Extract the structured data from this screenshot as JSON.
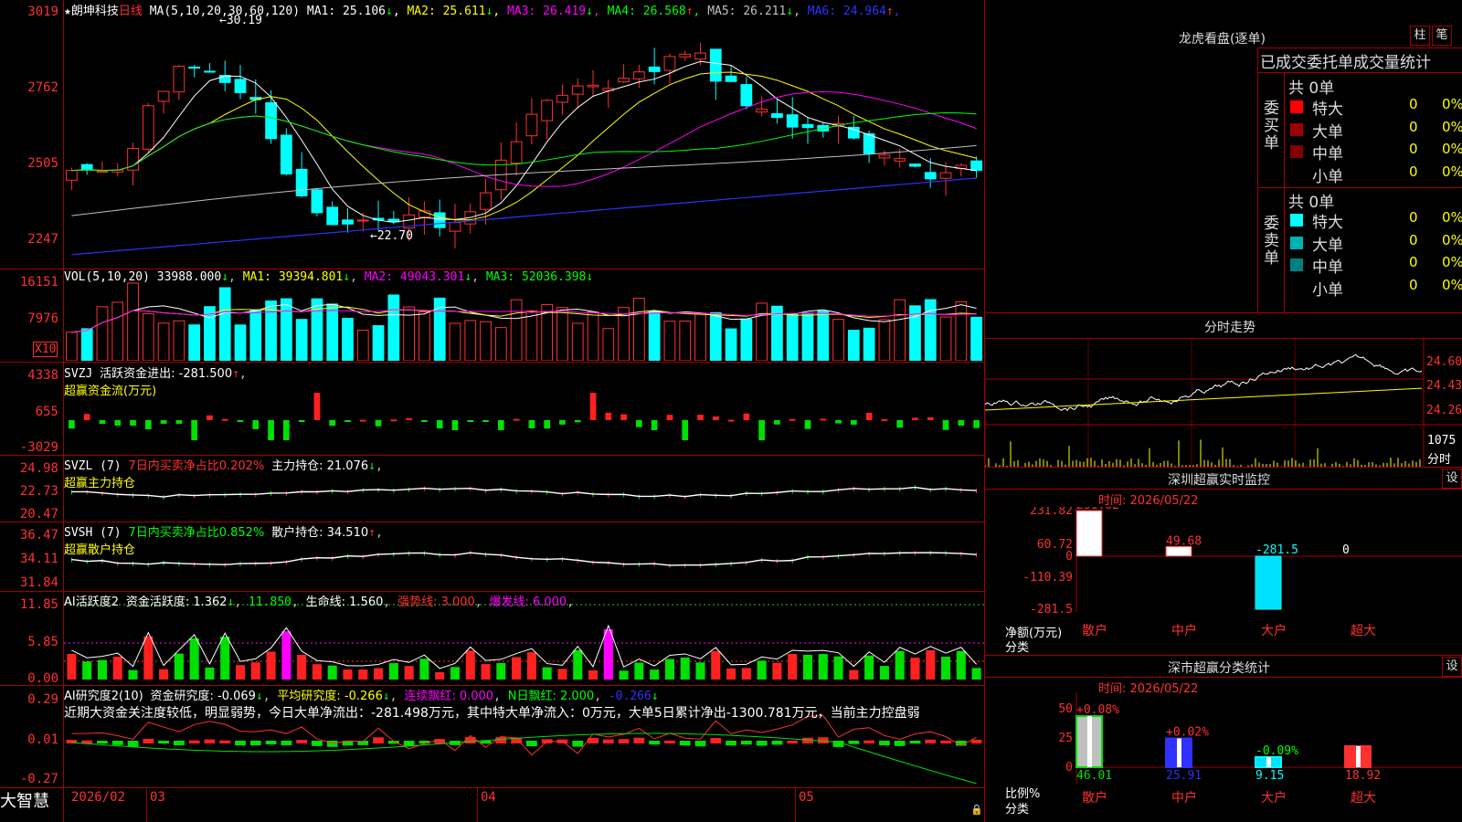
{
  "stock": {
    "name": "朗坤科技",
    "period": "日线"
  },
  "main": {
    "ma_label": "MA(5,10,20,30,60,120)",
    "ma": [
      {
        "label": "MA1:",
        "value": "25.106",
        "arrow": "↓",
        "color": "#ffffff"
      },
      {
        "label": "MA2:",
        "value": "25.611",
        "arrow": "↓",
        "color": "#ffff00"
      },
      {
        "label": "MA3:",
        "value": "26.419",
        "arrow": "↓",
        "color": "#ff00ff"
      },
      {
        "label": "MA4:",
        "value": "26.568",
        "arrow": "↑",
        "color": "#00ff00"
      },
      {
        "label": "MA5:",
        "value": "26.211",
        "arrow": "↓",
        "color": "#c0c0c0"
      },
      {
        "label": "MA6:",
        "value": "24.964",
        "arrow": "↑",
        "color": "#3030ff"
      }
    ],
    "yticks": [
      "3019",
      "2762",
      "2505",
      "2247"
    ],
    "high_label": "30.19",
    "low_label": "22.70"
  },
  "vol": {
    "label": "VOL(5,10,20)",
    "value": "33988.000",
    "ma1": "MA1: 39394.801",
    "ma2": "MA2: 49043.301",
    "ma3": "MA3: 52036.398",
    "yticks": [
      "16151",
      "7976"
    ],
    "unit": "X10"
  },
  "svzj": {
    "label": "SVZJ",
    "desc": "活跃资金进出: -281.500",
    "arrow": "↑",
    "sub": "超赢资金流(万元)",
    "yticks": [
      "4338",
      "655",
      "-3029"
    ]
  },
  "svzl": {
    "label": "SVZL (7)",
    "ratio": "7日内买卖净占比0.202%",
    "main": "主力持仓: 21.076",
    "arrow": "↓",
    "sub": "超赢主力持仓",
    "yticks": [
      "24.98",
      "22.73",
      "20.47"
    ]
  },
  "svsh": {
    "label": "SVSH (7)",
    "ratio": "7日内买卖净占比0.852%",
    "main": "散户持仓: 34.510",
    "arrow": "↑",
    "sub": "超赢散户持仓",
    "yticks": [
      "36.47",
      "34.11",
      "31.84"
    ]
  },
  "ai2": {
    "label": "AI活跃度2",
    "a": "资金活跃度: 1.362",
    "b": "11.850",
    "c": "生命线: 1.560",
    "d": "强势线: 3.000",
    "e": "爆发线: 6.000",
    "yticks": [
      "11.85",
      "5.85",
      "0.00"
    ]
  },
  "ai3": {
    "label": "AI研究度2(10)",
    "a": "资金研究度: -0.069",
    "b": "平均研究度: -0.266",
    "c": "连续飘红: 0.000",
    "d": "N日飘红: 2.000",
    "e": "-0.266",
    "comment": "近期大资金关注度较低，明显弱势，今日大单净流出：-281.498万元，其中特大单净流入：0万元，大单5日累计净出-1300.781万元，当前主力控盘弱",
    "yticks": [
      "0.29",
      "0.01",
      "-0.27"
    ]
  },
  "xaxis": {
    "labels": [
      "2026/02",
      "03",
      "04",
      "05"
    ]
  },
  "brand": "大智慧",
  "right": {
    "lhb_title": "龙虎看盘(逐单)",
    "btn_a": "柱",
    "btn_b": "笔",
    "stat_title": "已成交委托单成交量统计",
    "buy": {
      "group": "委买单",
      "total": "共 0单",
      "rows": [
        {
          "label": "特大",
          "v": "0",
          "p": "0%",
          "color": "#ff0000"
        },
        {
          "label": "大单",
          "v": "0",
          "p": "0%",
          "color": "#a00000"
        },
        {
          "label": "中单",
          "v": "0",
          "p": "0%",
          "color": "#800000"
        },
        {
          "label": "小单",
          "v": "0",
          "p": "0%",
          "color": ""
        }
      ]
    },
    "sell": {
      "group": "委卖单",
      "total": "共 0单",
      "rows": [
        {
          "label": "特大",
          "v": "0",
          "p": "0%",
          "color": "#00ffff"
        },
        {
          "label": "大单",
          "v": "0",
          "p": "0%",
          "color": "#00b0b0"
        },
        {
          "label": "中单",
          "v": "0",
          "p": "0%",
          "color": "#008080"
        },
        {
          "label": "小单",
          "v": "0",
          "p": "0%",
          "color": ""
        }
      ]
    },
    "fs_title": "分时走势",
    "fs_y": [
      "24.60",
      "24.43",
      "24.26"
    ],
    "fs_vol": "1075",
    "fs_unit": "分时",
    "mon_title": "深圳超赢实时监控",
    "mon_btn": "设",
    "mon_time": "时间: 2026/05/22",
    "mon_y": [
      "231.82",
      "60.72",
      "0",
      "-110.39",
      "-281.5"
    ],
    "mon_unit": "净额(万元)",
    "mon_cat_label": "分类",
    "mon_bars": [
      {
        "cat": "散户",
        "value": "231.82"
      },
      {
        "cat": "中户",
        "value": "49.68"
      },
      {
        "cat": "大户",
        "value": "-281.5"
      },
      {
        "cat": "超大",
        "value": "0"
      }
    ],
    "cls_title": "深市超赢分类统计",
    "cls_btn": "设",
    "cls_time": "时间: 2026/05/22",
    "cls_y": [
      "75",
      "50",
      "25",
      "0"
    ],
    "cls_unit": "比例%",
    "cls_cat_label": "分类",
    "cls_bars": [
      {
        "cat": "散户",
        "top": "+0.08%",
        "value": "46.01"
      },
      {
        "cat": "中户",
        "top": "+0.02%",
        "value": "25.91"
      },
      {
        "cat": "大户",
        "top": "-0.09%",
        "value": "9.15"
      },
      {
        "cat": "超大",
        "top": "",
        "value": "18.92"
      }
    ]
  },
  "chart_data": [
    {
      "type": "line",
      "title": "朗坤科技 日线",
      "series": [
        {
          "name": "MA1",
          "values": [
            25.106
          ]
        },
        {
          "name": "MA2",
          "values": [
            25.611
          ]
        },
        {
          "name": "MA3",
          "values": [
            26.419
          ]
        },
        {
          "name": "MA4",
          "values": [
            26.568
          ]
        },
        {
          "name": "MA5",
          "values": [
            26.211
          ]
        },
        {
          "name": "MA6",
          "values": [
            24.964
          ]
        }
      ],
      "ylim": [
        22.47,
        30.19
      ],
      "yticks": [
        30.19,
        27.62,
        25.05,
        22.47
      ],
      "annotations": [
        "30.19",
        "22.70"
      ]
    },
    {
      "type": "bar",
      "title": "VOL(5,10,20)",
      "values": [
        33988.0
      ],
      "ylim": [
        0,
        161510
      ]
    },
    {
      "type": "bar",
      "title": "深圳超赢实时监控",
      "categories": [
        "散户",
        "中户",
        "大户",
        "超大"
      ],
      "values": [
        231.82,
        49.68,
        -281.5,
        0
      ],
      "ylim": [
        -281.5,
        231.82
      ]
    },
    {
      "type": "bar",
      "title": "深市超赢分类统计",
      "categories": [
        "散户",
        "中户",
        "大户",
        "超大"
      ],
      "values": [
        46.01,
        25.91,
        9.15,
        18.92
      ],
      "ylim": [
        0,
        75
      ]
    }
  ]
}
